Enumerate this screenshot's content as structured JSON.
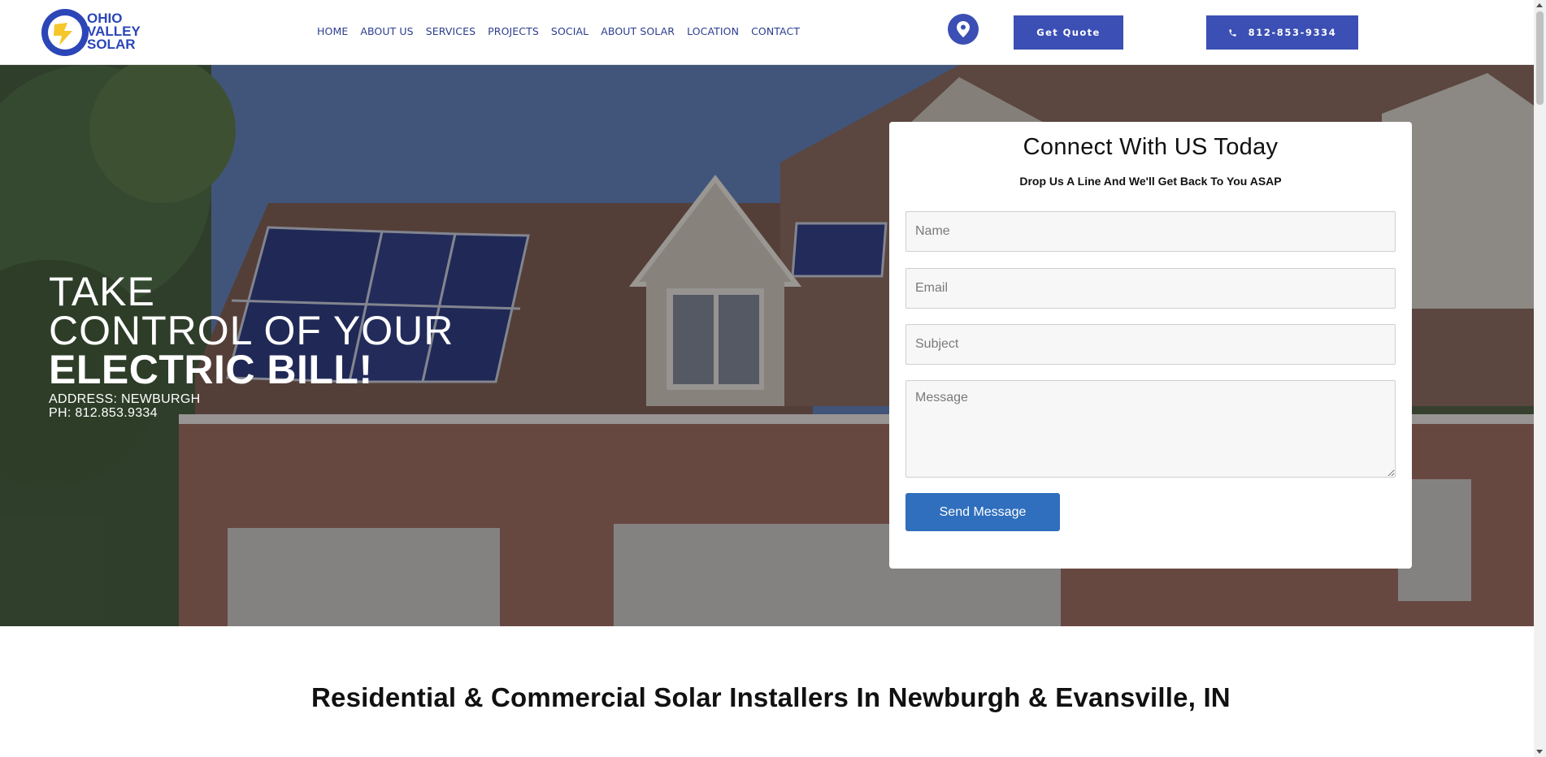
{
  "brand": {
    "logo_line1": "OHIO",
    "logo_line2": "VALLEY",
    "logo_line3": "SOLAR",
    "primary_color": "#3b4fb4",
    "accent_color": "#f5c72a"
  },
  "nav": {
    "items": [
      "HOME",
      "ABOUT US",
      "SERVICES",
      "PROJECTS",
      "SOCIAL",
      "ABOUT SOLAR",
      "LOCATION",
      "CONTACT"
    ]
  },
  "header": {
    "location_icon": "map-pin-icon",
    "quote_label": "Get Quote",
    "phone_icon": "phone-icon",
    "phone_label": "812-853-9334"
  },
  "hero": {
    "line1": "TAKE",
    "line2": "CONTROL OF YOUR",
    "line3": "ELECTRIC BILL!",
    "address": "ADDRESS: NEWBURGH",
    "phone": "PH: 812.853.9334"
  },
  "form": {
    "title": "Connect With US Today",
    "subtitle": "Drop Us A Line And We'll Get Back To You ASAP",
    "name_placeholder": "Name",
    "email_placeholder": "Email",
    "subject_placeholder": "Subject",
    "message_placeholder": "Message",
    "submit_label": "Send Message",
    "submit_color": "#2f6fbd"
  },
  "section": {
    "title": "Residential & Commercial Solar Installers In Newburgh & Evansville, IN"
  }
}
